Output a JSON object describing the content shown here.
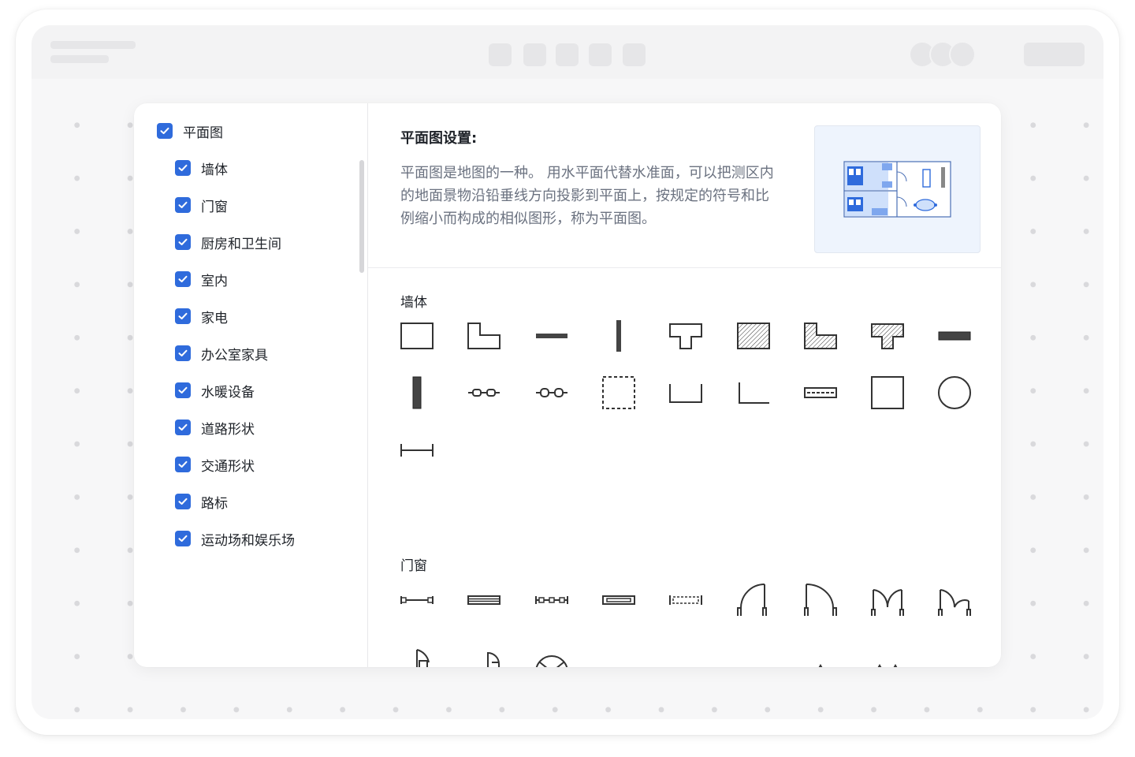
{
  "categories": [
    {
      "label": "平面图",
      "checked": true,
      "level": 0
    },
    {
      "label": "墙体",
      "checked": true,
      "level": 1
    },
    {
      "label": "门窗",
      "checked": true,
      "level": 1
    },
    {
      "label": "厨房和卫生间",
      "checked": true,
      "level": 1
    },
    {
      "label": "室内",
      "checked": true,
      "level": 1
    },
    {
      "label": "家电",
      "checked": true,
      "level": 1
    },
    {
      "label": "办公室家具",
      "checked": true,
      "level": 1
    },
    {
      "label": "水暖设备",
      "checked": true,
      "level": 1
    },
    {
      "label": "道路形状",
      "checked": true,
      "level": 1
    },
    {
      "label": "交通形状",
      "checked": true,
      "level": 1
    },
    {
      "label": "路标",
      "checked": true,
      "level": 1
    },
    {
      "label": "运动场和娱乐场",
      "checked": true,
      "level": 1
    }
  ],
  "detail": {
    "title": "平面图设置:",
    "description": "平面图是地图的一种。 用水平面代替水准面，可以把测区内的地面景物沿铅垂线方向投影到平面上，按规定的符号和比例缩小而构成的相似图形，称为平面图。"
  },
  "sections": [
    {
      "label": "墙体",
      "shapes": [
        "rect-wall-icon",
        "l-wall-icon",
        "horizontal-wall-icon",
        "vertical-wall-icon",
        "t-wall-icon",
        "hatched-rect-wall-icon",
        "hatched-l-wall-icon",
        "hatched-t-wall-icon",
        "thick-horizontal-wall-icon",
        "thick-vertical-wall-icon",
        "wall-chain-icon",
        "wall-chain-alt-icon",
        "dashed-room-icon",
        "u-wall-icon",
        "corner-wall-icon",
        "dashed-wall-icon",
        "square-room-icon",
        "circle-room-icon",
        "dimension-line-icon"
      ]
    },
    {
      "label": "门窗",
      "shapes": [
        "window-icon",
        "double-window-icon",
        "sliding-window-icon",
        "frame-window-icon",
        "dashed-window-icon",
        "door-left-icon",
        "door-right-icon",
        "double-door-icon",
        "double-door-alt-icon",
        "revolving-door-icon",
        "bifold-door-icon",
        "round-door-icon",
        "opening-icon",
        "opening-alt-icon",
        "wall-opening-icon",
        "folding-door-icon",
        "folding-door-alt-icon",
        "framed-opening-icon"
      ]
    }
  ],
  "colors": {
    "accent": "#2f6bdc",
    "text": "#1f2329",
    "muted": "#6b7280",
    "stroke": "#333333"
  }
}
